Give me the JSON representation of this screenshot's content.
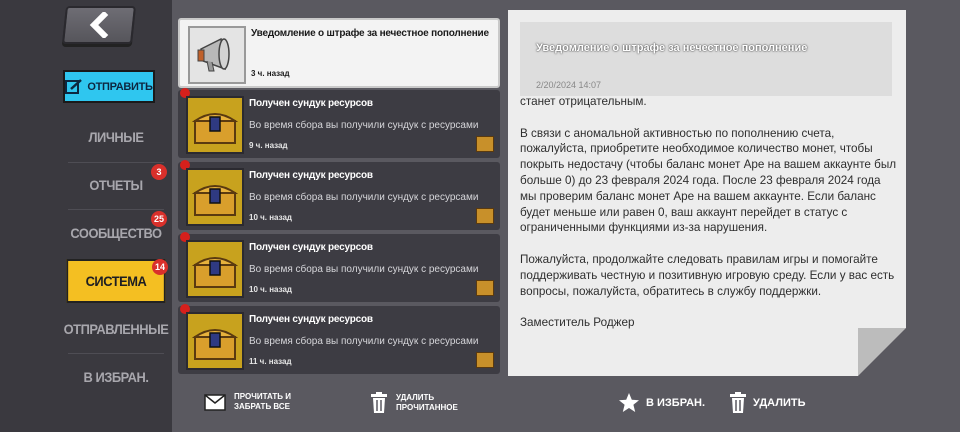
{
  "sidebar": {
    "send_label": "ОТПРАВИТЬ",
    "items": [
      {
        "label": "ЛИЧНЫЕ",
        "badge": ""
      },
      {
        "label": "ОТЧЕТЫ",
        "badge": "3"
      },
      {
        "label": "СООБЩЕСТВО",
        "badge": "25"
      },
      {
        "label": "СИСТЕМА",
        "badge": "14"
      },
      {
        "label": "ОТПРАВЛЕННЫЕ",
        "badge": ""
      },
      {
        "label": "В ИЗБРАН.",
        "badge": ""
      }
    ]
  },
  "messages": [
    {
      "title": "Уведомление о штрафе за нечестное пополнение",
      "preview": "",
      "time": "3 ч. назад",
      "icon": "megaphone-icon"
    },
    {
      "title": "Получен сундук ресурсов",
      "preview": "Во время сбора вы получили сундук с ресурсами",
      "time": "9 ч. назад",
      "icon": "chest-icon"
    },
    {
      "title": "Получен сундук ресурсов",
      "preview": "Во время сбора вы получили сундук с ресурсами",
      "time": "10 ч. назад",
      "icon": "chest-icon"
    },
    {
      "title": "Получен сундук ресурсов",
      "preview": "Во время сбора вы получили сундук с ресурсами",
      "time": "10 ч. назад",
      "icon": "chest-icon"
    },
    {
      "title": "Получен сундук ресурсов",
      "preview": "Во время сбора вы получили сундук с ресурсами",
      "time": "11 ч. назад",
      "icon": "chest-icon"
    }
  ],
  "list_actions": {
    "read_collect_line1": "ПРОЧИТАТЬ И",
    "read_collect_line2": "ЗАБРАТЬ ВСЕ",
    "delete_read_line1": "УДАЛИТЬ",
    "delete_read_line2": "ПРОЧИТАННОЕ"
  },
  "detail": {
    "title": "Уведомление о штрафе за нечестное пополнение",
    "date": "2/20/2024 14:07",
    "paragraphs": [
      "станет отрицательным.",
      "В связи с аномальной активностью по пополнению счета, пожалуйста, приобретите необходимое количество монет, чтобы покрыть недостачу (чтобы баланс монет Ape на вашем аккаунте был больше 0) до 23 февраля 2024 года. После 23 февраля 2024 года мы проверим баланс монет Ape на вашем аккаунте. Если баланс будет меньше или равен 0, ваш аккаунт перейдет в статус с ограниченными функциями из-за нарушения.",
      "Пожалуйста, продолжайте следовать правилам игры и помогайте поддерживать честную и позитивную игровую среду. Если у вас есть вопросы, пожалуйста, обратитесь в службу поддержки.",
      "Заместитель Роджер"
    ],
    "favorite_label": "В ИЗБРАН.",
    "delete_label": "УДАЛИТЬ"
  },
  "colors": {
    "accent_yellow": "#f4bf22",
    "send_blue": "#2fc6ef",
    "badge_red": "#d9302b"
  }
}
